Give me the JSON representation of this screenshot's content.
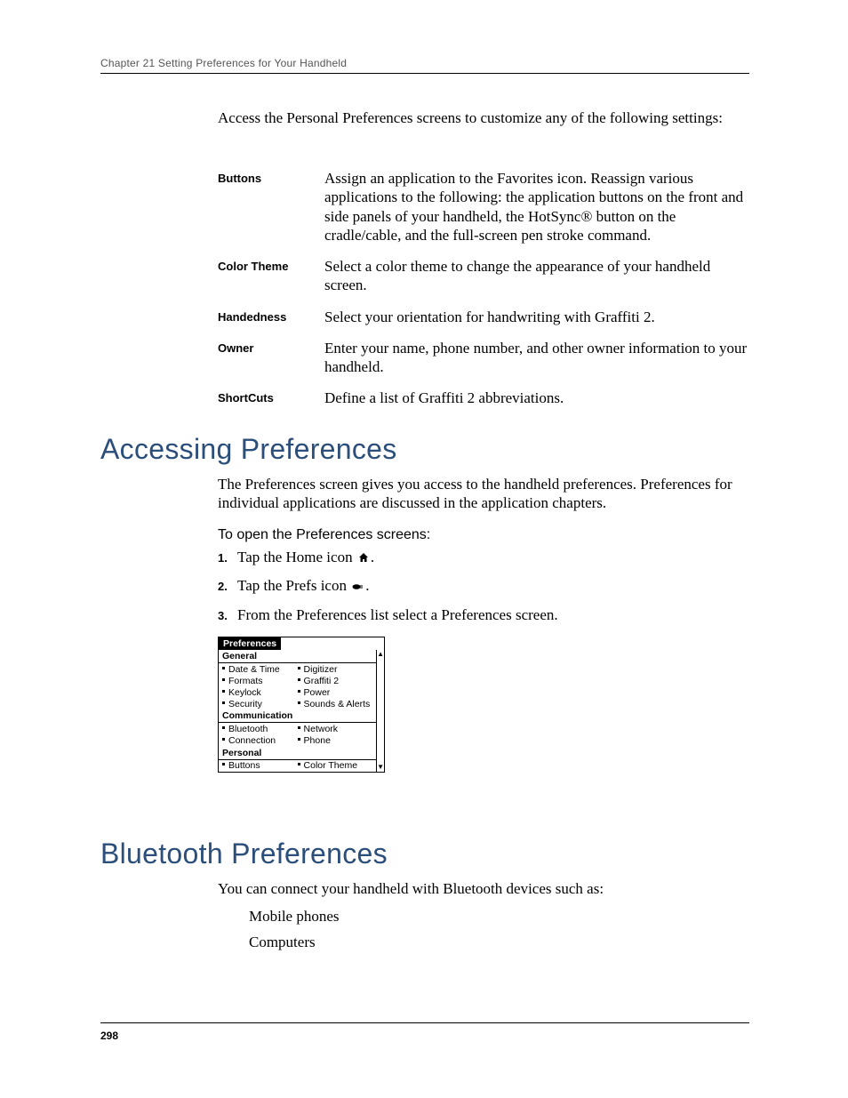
{
  "header": {
    "running": "Chapter 21   Setting Preferences for Your Handheld"
  },
  "intro": "Access the Personal Preferences screens to customize any of the following settings:",
  "definitions": [
    {
      "label": "Buttons",
      "text": "Assign an application to the Favorites icon. Reassign various applications to the following: the application buttons on the front and side panels of your handheld, the HotSync® button on the cradle/cable, and the full-screen pen stroke command."
    },
    {
      "label": "Color Theme",
      "text": "Select a color theme to change the appearance of your handheld screen."
    },
    {
      "label": "Handedness",
      "text": "Select your orientation for handwriting with Graffiti 2."
    },
    {
      "label": "Owner",
      "text": "Enter your name, phone number, and other owner information to your handheld."
    },
    {
      "label": "ShortCuts",
      "text": "Define a list of Graffiti 2 abbreviations."
    }
  ],
  "section_accessing": {
    "title": "Accessing Preferences",
    "intro": "The Preferences screen gives you access to the handheld preferences. Preferences for individual applications are discussed in the application chapters.",
    "steps_title": "To open the Preferences screens:",
    "steps": [
      {
        "pre": "Tap the Home icon ",
        "icon": "home-icon",
        "post": "."
      },
      {
        "pre": "Tap the Prefs icon ",
        "icon": "prefs-icon",
        "post": "."
      },
      {
        "pre": "From the Preferences list select a Preferences screen.",
        "icon": null,
        "post": ""
      }
    ]
  },
  "prefs_panel": {
    "title": "Preferences",
    "groups": [
      {
        "heading": "General",
        "rows": [
          [
            "Date & Time",
            "Digitizer"
          ],
          [
            "Formats",
            "Graffiti 2"
          ],
          [
            "Keylock",
            "Power"
          ],
          [
            "Security",
            "Sounds & Alerts"
          ]
        ]
      },
      {
        "heading": "Communication",
        "rows": [
          [
            "Bluetooth",
            "Network"
          ],
          [
            "Connection",
            "Phone"
          ]
        ]
      },
      {
        "heading": "Personal",
        "rows": [
          [
            "Buttons",
            "Color Theme"
          ]
        ]
      }
    ]
  },
  "section_bluetooth": {
    "title": "Bluetooth Preferences",
    "intro": "You can connect your handheld with Bluetooth devices such as:",
    "items": [
      "Mobile phones",
      "Computers"
    ]
  },
  "footer": {
    "page": "298"
  }
}
